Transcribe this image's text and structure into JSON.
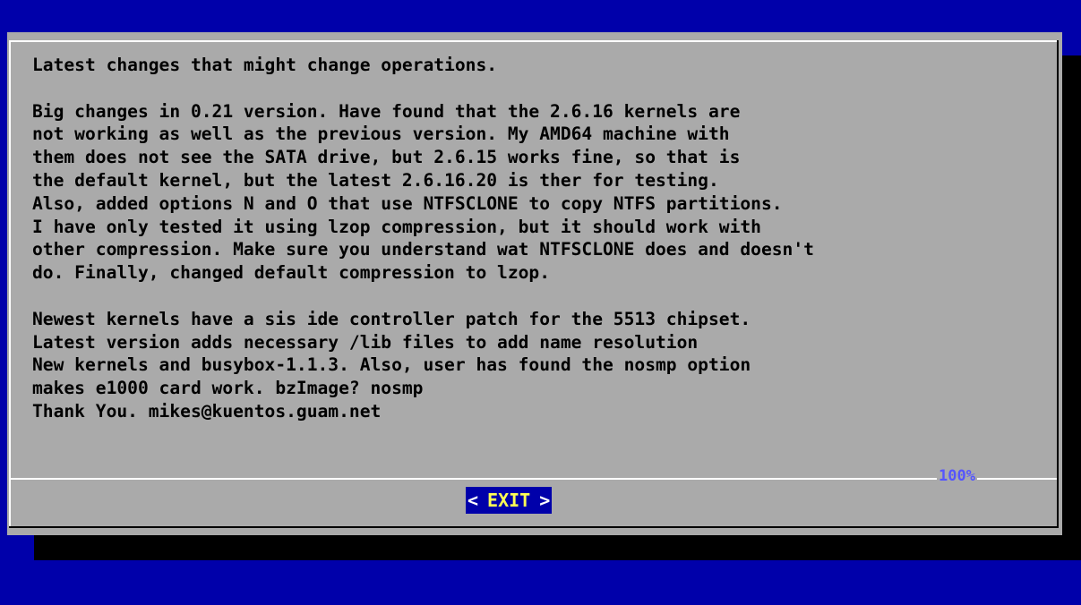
{
  "colors": {
    "background": "#0000aa",
    "dialog": "#aaaaaa",
    "shadow": "#000000",
    "text": "#000000",
    "percent": "#5555ff",
    "button_bg": "#0000aa",
    "button_text": "#ffff55",
    "button_brackets": "#ffffff"
  },
  "dialog": {
    "text_lines": [
      "Latest changes that might change operations.",
      "",
      "Big changes in 0.21 version. Have found that the 2.6.16 kernels are",
      "not working as well as the previous version. My AMD64 machine with",
      "them does not see the SATA drive, but 2.6.15 works fine, so that is",
      "the default kernel, but the latest 2.6.16.20 is ther for testing.",
      "Also, added options N and O that use NTFSCLONE to copy NTFS partitions.",
      "I have only tested it using lzop compression, but it should work with",
      "other compression. Make sure you understand wat NTFSCLONE does and doesn't",
      "do. Finally, changed default compression to lzop.",
      "",
      "Newest kernels have a sis ide controller patch for the 5513 chipset.",
      "Latest version adds necessary /lib files to add name resolution",
      "New kernels and busybox-1.1.3. Also, user has found the nosmp option",
      "makes e1000 card work. bzImage? nosmp",
      "Thank You. mikes@kuentos.guam.net"
    ],
    "scroll_percent": "100%",
    "exit_left": "<",
    "exit_label": "EXIT",
    "exit_right": ">"
  }
}
